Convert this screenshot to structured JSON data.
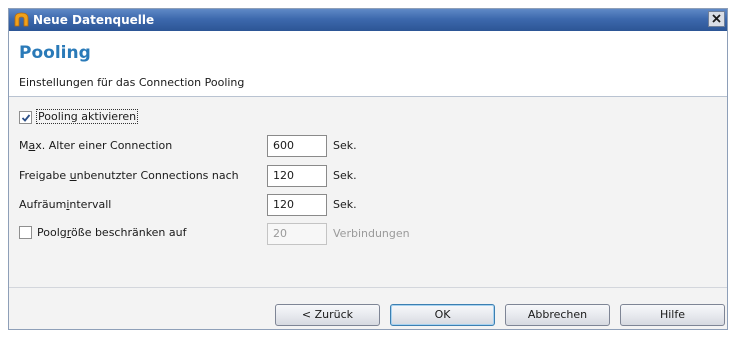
{
  "window": {
    "title": "Neue Datenquelle",
    "close_label": "close"
  },
  "header": {
    "title": "Pooling",
    "subtitle": "Einstellungen für das Connection Pooling"
  },
  "form": {
    "pooling_enable": {
      "label": "Pooling aktivieren",
      "checked": true
    },
    "max_age": {
      "label_pre": "M",
      "label_mnemonic": "a",
      "label_post": "x. Alter einer Connection",
      "value": "600",
      "unit": "Sek."
    },
    "release_unused": {
      "label_pre": "Freigabe ",
      "label_mnemonic": "u",
      "label_post": "nbenutzter Connections nach",
      "value": "120",
      "unit": "Sek."
    },
    "cleanup_interval": {
      "label_pre": "Aufräum",
      "label_mnemonic": "i",
      "label_post": "ntervall",
      "value": "120",
      "unit": "Sek."
    },
    "pool_size": {
      "label_pre": "Poolg",
      "label_mnemonic": "r",
      "label_post": "öße beschränken auf",
      "checked": false,
      "value": "20",
      "unit": "Verbindungen"
    }
  },
  "buttons": {
    "back": "< Zurück",
    "ok": "OK",
    "cancel": "Abbrechen",
    "help": "Hilfe"
  },
  "colors": {
    "title_accent": "#2a7ab8",
    "titlebar": "#3d69ad",
    "default_button_border": "#3c7fb1"
  }
}
